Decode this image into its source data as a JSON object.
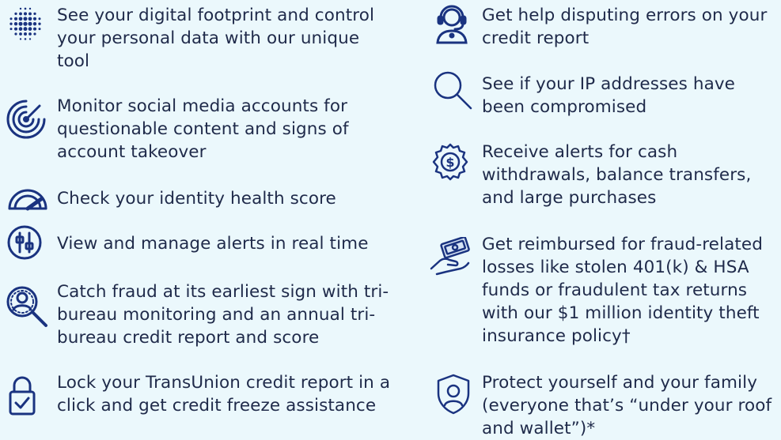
{
  "left_features": [
    {
      "icon": "dot-globe-icon",
      "text": "See your digital footprint and control your personal data with our unique tool"
    },
    {
      "icon": "radar-icon",
      "text": "Monitor social media accounts for questionable content and signs of account takeover"
    },
    {
      "icon": "speedometer-icon",
      "text": "Check your identity health score"
    },
    {
      "icon": "sliders-icon",
      "text": "View and manage alerts in real time"
    },
    {
      "icon": "person-magnifier-icon",
      "text": "Catch fraud at its earliest sign with tri-bureau monitoring and an annual tri-bureau credit report and score"
    },
    {
      "icon": "padlock-check-icon",
      "text": "Lock your TransUnion credit report in a click and get credit freeze assistance"
    }
  ],
  "right_features": [
    {
      "icon": "support-agent-icon",
      "text": "Get help disputing errors on your credit report"
    },
    {
      "icon": "search-icon",
      "text": "See if your IP addresses have been compromised"
    },
    {
      "icon": "dollar-badge-icon",
      "text": "Receive alerts for cash withdrawals, balance transfers, and large purchases"
    },
    {
      "icon": "hand-money-icon",
      "text": "Get reimbursed for fraud-related losses like stolen 401(k) & HSA funds or fraudulent tax returns with our $1 million identity theft insurance policy†"
    },
    {
      "icon": "shield-user-icon",
      "text": "Protect yourself and your family (everyone that’s “under your roof and wallet”)*"
    }
  ],
  "colors": {
    "background": "#ebf8fc",
    "text": "#1f2a4a",
    "icon": "#1a3380"
  }
}
